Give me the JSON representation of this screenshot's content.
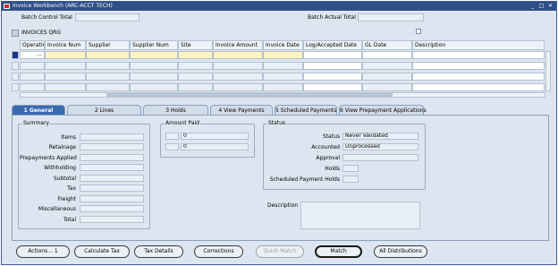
{
  "window": {
    "title": "Invoice Workbench (ARC-ACCT TECH)",
    "controls": [
      "_",
      "□",
      "✕"
    ]
  },
  "header": {
    "batch_control_total_label": "Batch Control Total",
    "batch_actual_total_label": "Batch Actual Total",
    "invoices_title": "INVOICES QRG"
  },
  "grid": {
    "columns": [
      "Operatin",
      "Invoice Num",
      "Supplier",
      "Supplier Num",
      "Site",
      "Invoice Amount",
      "Invoice Date",
      "Log/Accepted Date",
      "GL Date",
      "Description"
    ],
    "first_row_lov": "..."
  },
  "tabs": [
    {
      "label": "1 General",
      "active": true
    },
    {
      "label": "2 Lines",
      "active": false
    },
    {
      "label": "3 Holds",
      "active": false
    },
    {
      "label": "4 View Payments",
      "active": false
    },
    {
      "label": "5 Scheduled Payments",
      "active": false
    },
    {
      "label": "6 View Prepayment Applications",
      "active": false
    }
  ],
  "summary": {
    "title": "Summary",
    "rows": [
      "Items",
      "Retainage",
      "Prepayments Applied",
      "Withholding",
      "Subtotal",
      "Tax",
      "Freight",
      "Miscellaneous",
      "Total"
    ]
  },
  "amount_paid": {
    "title": "Amount Paid",
    "values": [
      "0",
      "0"
    ]
  },
  "status": {
    "title": "Status",
    "status_label": "Status",
    "status_value": "Never Validated",
    "accounted_label": "Accounted",
    "accounted_value": "Unprocessed",
    "approval_label": "Approval",
    "holds_label": "Holds",
    "scheduled_holds_label": "Scheduled Payment Holds"
  },
  "description_label": "Description",
  "buttons": [
    {
      "label": "Actions... 1",
      "enabled": true
    },
    {
      "label": "Calculate Tax",
      "enabled": true
    },
    {
      "label": "Tax Details",
      "enabled": true
    },
    {
      "label": "Corrections",
      "enabled": true
    },
    {
      "label": "Quick Match",
      "enabled": false
    },
    {
      "label": "Match",
      "enabled": true
    },
    {
      "label": "All Distributions",
      "enabled": true
    }
  ],
  "colors": {
    "titlebar": "#2f4f88",
    "active_tab": "#3a6bb2",
    "current_row": "#1e2f8c",
    "required_field": "#fff3c4"
  }
}
